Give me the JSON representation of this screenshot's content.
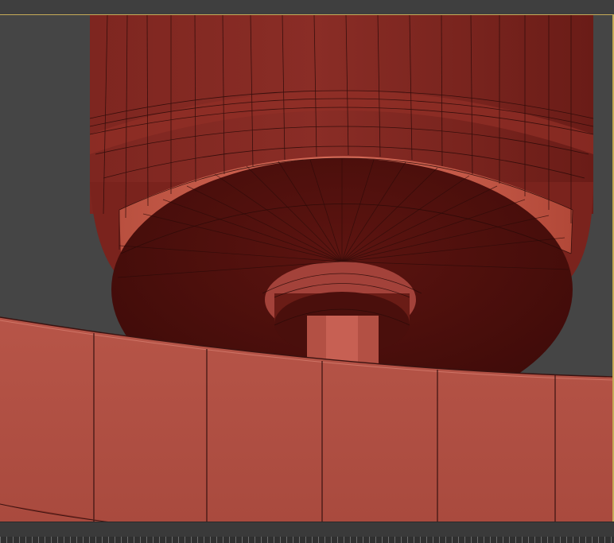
{
  "viewport": {
    "label": "",
    "colors": {
      "background": "#454545",
      "active_border": "#c6ab58",
      "mesh_dark": "#5c1410",
      "mesh_mid": "#8f2d25",
      "mesh_light": "#c65a4d",
      "wire": "#2a0a08"
    },
    "objects": [
      "cylinder-mesh",
      "curved-panel-mesh"
    ]
  },
  "timeline": {
    "icon": "time-ruler"
  }
}
